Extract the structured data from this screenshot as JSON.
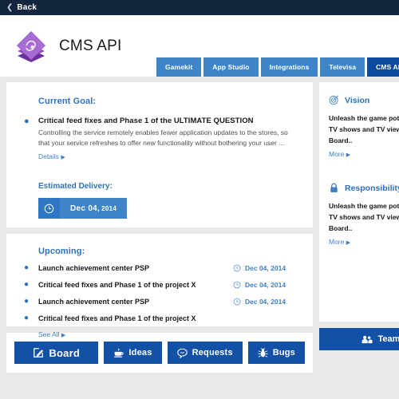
{
  "backbar": {
    "label": "Back",
    "icon": "chevron-left-icon"
  },
  "header": {
    "app_title": "CMS API",
    "logo_icon": "stacked-layers-logo",
    "logo_colors": {
      "light": "#a96fd4",
      "mid": "#8e4cc0",
      "dark": "#6e2f9e"
    }
  },
  "tabs": [
    {
      "label": "Gamekit",
      "active": false
    },
    {
      "label": "App Studio",
      "active": false
    },
    {
      "label": "Integrations",
      "active": false
    },
    {
      "label": "Televisa",
      "active": false
    },
    {
      "label": "CMS API",
      "active": true
    },
    {
      "label": "",
      "active": false
    }
  ],
  "goal": {
    "section_title": "Current Goal:",
    "item_title": "Critical feed fixes and Phase 1 of the ULTIMATE QUESTION",
    "item_desc": "Controlling the service remotely enables fewer application updates to the stores, so that your service refreshes to offer new functionality without bothering your user ...",
    "details_link": "Details",
    "delivery_title": "Estimated Delivery:",
    "delivery_icon": "clock-icon",
    "delivery_date": "Dec 04,",
    "delivery_year": "2014"
  },
  "upcoming": {
    "section_title": "Upcoming:",
    "items": [
      {
        "label": "Launch achievement center PSP",
        "date": "Dec 04, 2014",
        "icon": "clock-icon"
      },
      {
        "label": "Critical feed fixes and Phase 1 of the project X",
        "date": "Dec 04, 2014",
        "icon": "clock-icon"
      },
      {
        "label": "Launch achievement center PSP",
        "date": "Dec 04, 2014",
        "icon": "clock-icon"
      },
      {
        "label": "Critical feed fixes and Phase 1 of the project X",
        "date": "",
        "icon": ""
      }
    ],
    "see_all_link": "See All"
  },
  "actions": [
    {
      "label": "Board",
      "icon": "pencil-square-icon"
    },
    {
      "label": "Ideas",
      "icon": "coffee-cup-icon"
    },
    {
      "label": "Requests",
      "icon": "speech-bubble-icon"
    },
    {
      "label": "Bugs",
      "icon": "bug-icon"
    }
  ],
  "sidebar": {
    "sections": [
      {
        "title": "Vision",
        "icon": "target-icon",
        "line1": "Unleash the game pot",
        "line2": "TV shows and TV view",
        "line3": "Board..",
        "more_link": "More"
      },
      {
        "title": "Responsibility",
        "icon": "lock-icon",
        "line1": "Unleash the game pot",
        "line2": "TV shows and TV view",
        "line3": "Board..",
        "more_link": "More"
      }
    ],
    "team_button": {
      "label": "Team",
      "icon": "people-icon"
    }
  },
  "colors": {
    "page_bg": "#e9e9e9",
    "topbar": "#13253c",
    "tab": "#3d85c8",
    "tab_active": "#0d4a9b",
    "link": "#3f7fc1",
    "heading": "#2d72b9",
    "button": "#1351a6"
  }
}
